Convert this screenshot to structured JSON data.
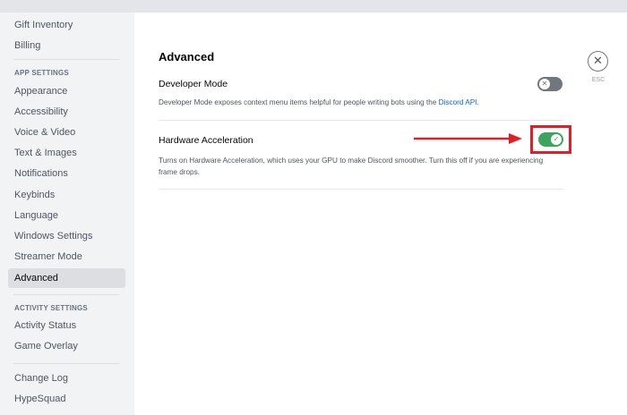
{
  "sidebar": {
    "items_top": [
      "Gift Inventory",
      "Billing"
    ],
    "app_settings_header": "APP SETTINGS",
    "app_settings_items": [
      "Appearance",
      "Accessibility",
      "Voice & Video",
      "Text & Images",
      "Notifications",
      "Keybinds",
      "Language",
      "Windows Settings",
      "Streamer Mode",
      "Advanced"
    ],
    "selected_item": "Advanced",
    "activity_settings_header": "ACTIVITY SETTINGS",
    "activity_items": [
      "Activity Status",
      "Game Overlay"
    ],
    "bottom_items": [
      "Change Log",
      "HypeSquad"
    ]
  },
  "main": {
    "title": "Advanced",
    "settings": [
      {
        "title": "Developer Mode",
        "description": "Developer Mode exposes context menu items helpful for people writing bots using the ",
        "link_text": "Discord API",
        "description_suffix": ".",
        "enabled": false,
        "knob_icon": "✕"
      },
      {
        "title": "Hardware Acceleration",
        "description": "Turns on Hardware Acceleration, which uses your GPU to make Discord smoother. Turn this off if you are experiencing frame drops.",
        "enabled": true,
        "knob_icon": "✓"
      }
    ]
  },
  "close": {
    "icon": "✕",
    "label": "ESC"
  },
  "annotation": {
    "color": "#e01e25",
    "arrow": "red-arrow",
    "box": "red-highlight-box"
  },
  "colors": {
    "toggle_on": "#3ba55d",
    "toggle_off": "#72767d",
    "link": "#0068e0",
    "sidebar_bg": "#f2f3f5"
  }
}
